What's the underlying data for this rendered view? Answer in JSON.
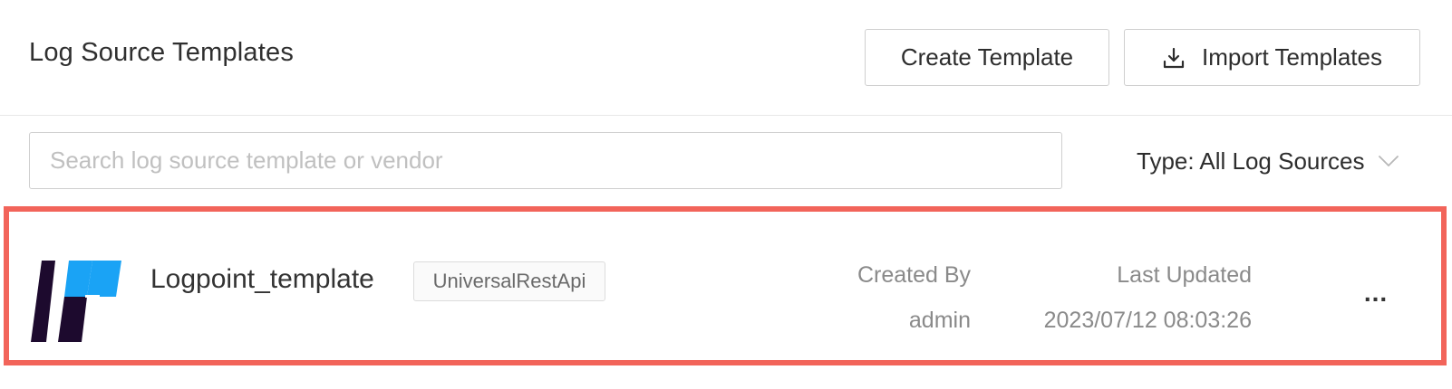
{
  "header": {
    "title": "Log Source Templates",
    "create_label": "Create Template",
    "import_label": "Import Templates"
  },
  "filters": {
    "search_placeholder": "Search log source template or vendor",
    "search_value": "",
    "type_label": "Type: All Log Sources"
  },
  "templates": [
    {
      "name": "Logpoint_template",
      "type_badge": "UniversalRestApi",
      "created_by_label": "Created By",
      "created_by": "admin",
      "last_updated_label": "Last Updated",
      "last_updated": "2023/07/12 08:03:26",
      "more_label": "..."
    }
  ],
  "icons": {
    "import": "download-icon",
    "type_dropdown": "chevron-down-icon",
    "logo": "logpoint-logo"
  },
  "colors": {
    "highlight_border": "#f2645a",
    "logo_dark": "#1d0a2e",
    "logo_blue": "#1aa3f5"
  }
}
